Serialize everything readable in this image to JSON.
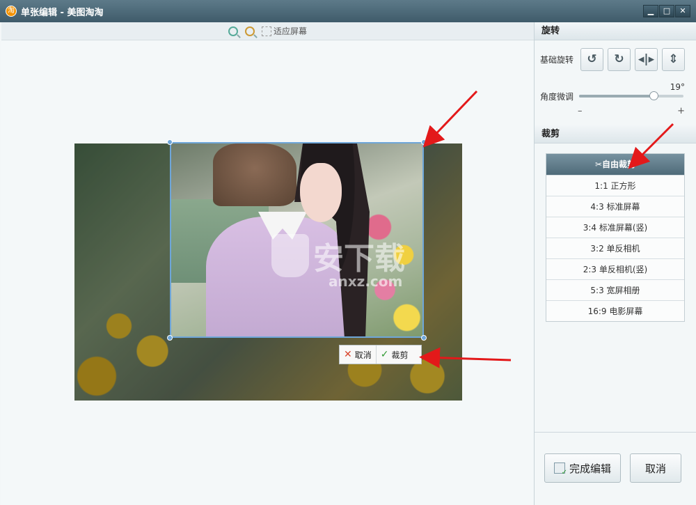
{
  "window": {
    "title": "单张编辑 - 美图淘淘",
    "logo_glyph": "淘",
    "minimize_glyph": "▁",
    "maximize_glyph": "□",
    "close_glyph": "✕"
  },
  "toolbar": {
    "fit_label": "适应屏幕"
  },
  "crop_actions": {
    "cancel_label": "取消",
    "confirm_label": "裁剪",
    "cancel_glyph": "✕",
    "confirm_glyph": "✓"
  },
  "watermark": {
    "text": "安下载",
    "sub": "anxz.com"
  },
  "rotate": {
    "section_title": "旋转",
    "basic_label": "基础旋转",
    "buttons": [
      "↺",
      "↻",
      "◂|▸",
      "⇕"
    ],
    "fine_label": "角度微调",
    "fine_value_text": "19°",
    "fine_value": 19,
    "fine_min": -45,
    "fine_max": 45,
    "minus": "–",
    "plus": "+"
  },
  "crop": {
    "section_title": "裁剪",
    "items": [
      {
        "label": "✂自由裁剪",
        "active": true
      },
      {
        "label": "1:1 正方形"
      },
      {
        "label": "4:3 标准屏幕"
      },
      {
        "label": "3:4 标准屏幕(竖)"
      },
      {
        "label": "3:2 单反相机"
      },
      {
        "label": "2:3 单反相机(竖)"
      },
      {
        "label": "5:3 宽屏相册"
      },
      {
        "label": "16:9 电影屏幕"
      }
    ]
  },
  "footer": {
    "done_label": "完成编辑",
    "cancel_label": "取消"
  },
  "colors": {
    "title_bar": "#4c6877",
    "crop_frame": "#6ea6d9",
    "active_item": "#5f7b89",
    "annotation_arrow": "#e3191a"
  }
}
